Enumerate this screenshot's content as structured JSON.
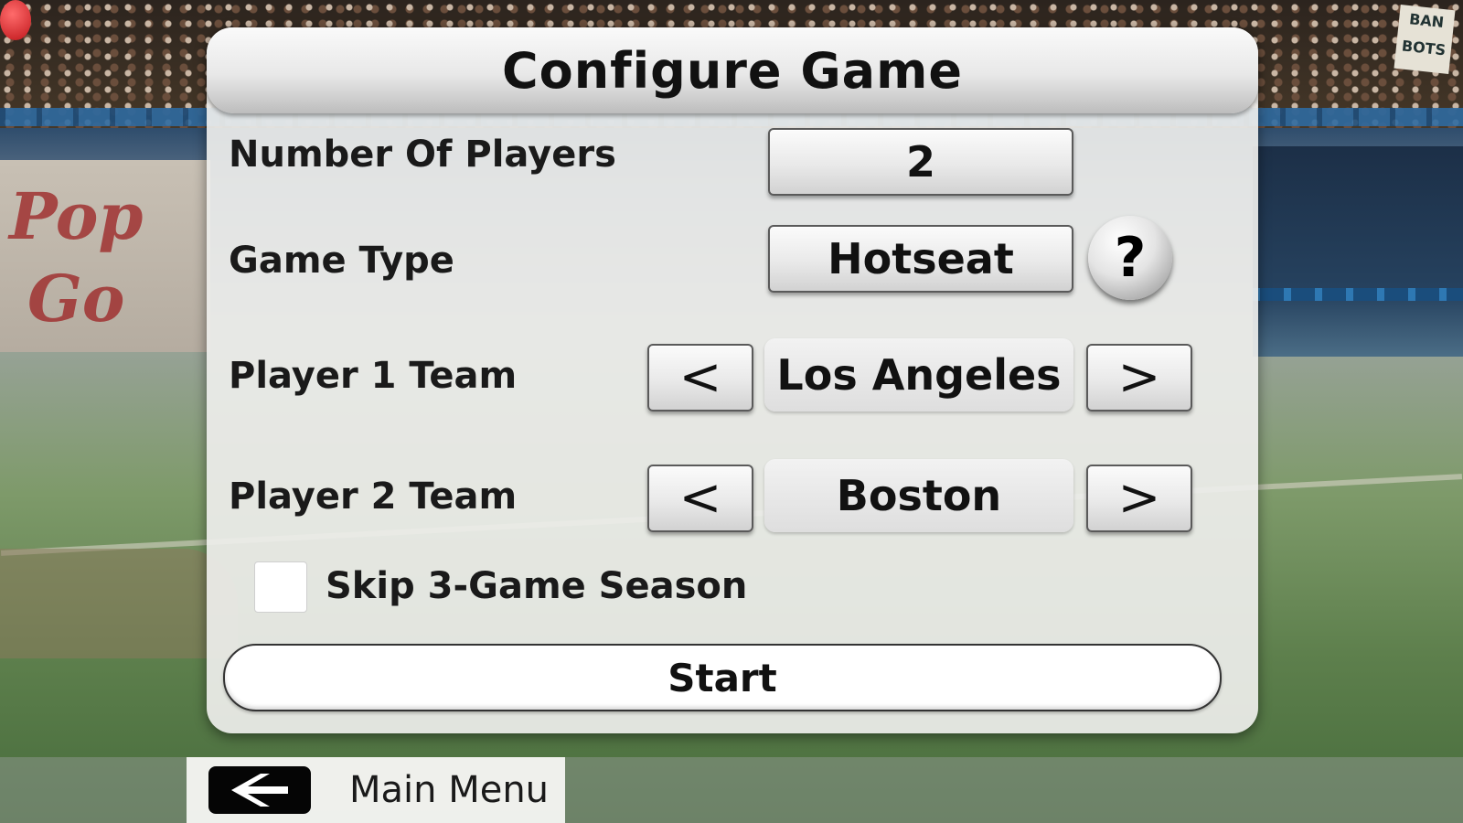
{
  "dialog": {
    "title": "Configure Game",
    "rows": {
      "num_players": {
        "label": "Number Of Players",
        "value": "2"
      },
      "game_type": {
        "label": "Game Type",
        "value": "Hotseat",
        "help_symbol": "?"
      },
      "player1_team": {
        "label": "Player 1 Team",
        "value": "Los Angeles",
        "prev_symbol": "<",
        "next_symbol": ">"
      },
      "player2_team": {
        "label": "Player 2 Team",
        "value": "Boston",
        "prev_symbol": "<",
        "next_symbol": ">"
      }
    },
    "skip_season": {
      "label": "Skip 3-Game Season",
      "checked": false
    },
    "start_label": "Start"
  },
  "bottom_bar": {
    "main_menu_label": "Main Menu",
    "back_icon": "back-arrow-icon"
  },
  "background": {
    "sign_text": "BAN BOTS"
  }
}
